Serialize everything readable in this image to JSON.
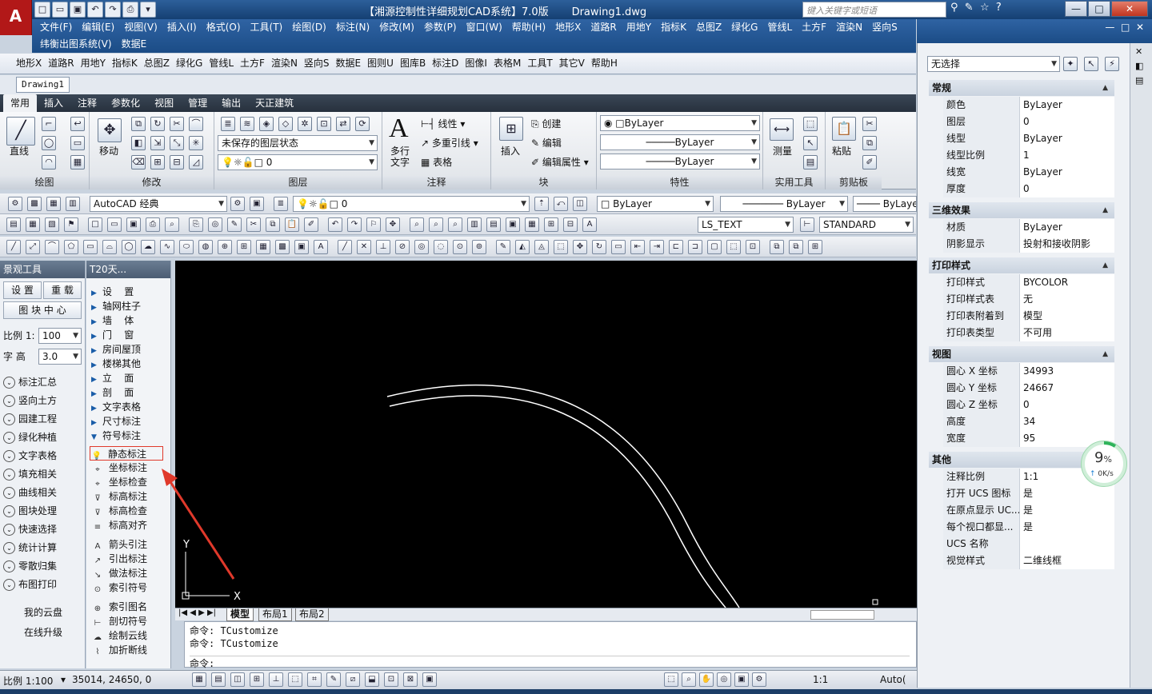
{
  "titlebar": {
    "app_logo": "A",
    "title": "【湘源控制性详细规划CAD系统】7.0版       Drawing1.dwg",
    "search_placeholder": "键入关键字或短语",
    "min": "—",
    "max": "□",
    "close": "✕"
  },
  "menubar": {
    "row1": [
      "文件(F)",
      "编辑(E)",
      "视图(V)",
      "插入(I)",
      "格式(O)",
      "工具(T)",
      "绘图(D)",
      "标注(N)",
      "修改(M)",
      "参数(P)",
      "窗口(W)",
      "帮助(H)",
      "地形X",
      "道路R",
      "用地Y",
      "指标K",
      "总图Z",
      "绿化G",
      "管线L",
      "土方F",
      "渲染N",
      "竖向S"
    ],
    "row2": [
      "纬衡出图系统(V)",
      "数据E"
    ]
  },
  "toolbar2": [
    "地形X",
    "道路R",
    "用地Y",
    "指标K",
    "总图Z",
    "绿化G",
    "管线L",
    "土方F",
    "渲染N",
    "竖向S",
    "数据E",
    "图则U",
    "图库B",
    "标注D",
    "图像I",
    "表格M",
    "工具T",
    "其它V",
    "帮助H"
  ],
  "doc_tab": "Drawing1",
  "ribbon_tabs": [
    "常用",
    "插入",
    "注释",
    "参数化",
    "视图",
    "管理",
    "输出",
    "天正建筑"
  ],
  "ribbon": {
    "draw_title": "绘图",
    "line_label": "直线",
    "modify_title": "修改",
    "move_label": "移动",
    "layers_title": "图层",
    "layer_state": "未保存的图层状态",
    "layer_current": "0",
    "annot_title": "注释",
    "mtext_label": "多行\n文字",
    "linear_label": "线性",
    "mleader_label": "多重引线",
    "table_label": "表格",
    "block_title": "块",
    "insert_label": "插入",
    "create_label": "创建",
    "edit_label": "编辑",
    "editattr_label": "编辑属性",
    "props_title": "特性",
    "color": "ByLayer",
    "linetype": "ByLayer",
    "lineweight": "ByLayer",
    "utils_title": "实用工具",
    "measure_label": "测量",
    "clip_title": "剪贴板",
    "paste_label": "粘贴"
  },
  "toolbar_ws": {
    "workspace": "AutoCAD 经典",
    "layer": "0",
    "color": "ByLayer",
    "linetype": "ByLayer",
    "lineweight": "ByLaye"
  },
  "toolbar_std": {
    "textstyle": "LS_TEXT",
    "dimstyle": "STANDARD"
  },
  "left_panel": {
    "title": "景观工具",
    "btn_settings": "设 置",
    "btn_redraw": "重 载",
    "btn_center": "图 块 中 心",
    "scale_label": "比例 1:",
    "scale_value": "100",
    "height_label": "字 高",
    "height_value": "3.0",
    "items": [
      "标注汇总",
      "竖向土方",
      "园建工程",
      "绿化种植",
      "文字表格",
      "填充相关",
      "曲线相关",
      "图块处理",
      "快速选择",
      "统计计算",
      "零散归集",
      "布图打印"
    ],
    "cloud": "我的云盘",
    "upgrade": "在线升级"
  },
  "t20_panel": {
    "title": "T20天...",
    "menu": [
      "设    置",
      "轴网柱子",
      "墙    体",
      "门    窗",
      "房间屋顶",
      "楼梯其他",
      "立    面",
      "剖    面",
      "文字表格",
      "尺寸标注",
      "符号标注"
    ],
    "sub": [
      "静态标注",
      "坐标标注",
      "坐标检查",
      "标高标注",
      "标高检查",
      "标高对齐",
      "箭头引注",
      "引出标注",
      "做法标注",
      "索引符号",
      "索引图名",
      "剖切符号",
      "绘制云线",
      "加折断线"
    ]
  },
  "canvas": {
    "axis_y": "Y",
    "axis_x": "X"
  },
  "layout_tabs": [
    "模型",
    "布局1",
    "布局2"
  ],
  "cmdline": {
    "line1": "命令: TCustomize",
    "line2": "命令: TCustomize",
    "prompt": "命令:"
  },
  "statusbar": {
    "scale": "比例 1:100",
    "coords": "35014, 24650, 0",
    "anno": "1:1",
    "brand": "Auto("
  },
  "props": {
    "selection": "无选择",
    "sections": [
      {
        "title": "常规",
        "rows": [
          [
            "颜色",
            "ByLayer"
          ],
          [
            "图层",
            "0"
          ],
          [
            "线型",
            "ByLayer"
          ],
          [
            "线型比例",
            "1"
          ],
          [
            "线宽",
            "ByLayer"
          ],
          [
            "厚度",
            "0"
          ]
        ]
      },
      {
        "title": "三维效果",
        "rows": [
          [
            "材质",
            "ByLayer"
          ],
          [
            "阴影显示",
            "投射和接收阴影"
          ]
        ]
      },
      {
        "title": "打印样式",
        "rows": [
          [
            "打印样式",
            "BYCOLOR"
          ],
          [
            "打印样式表",
            "无"
          ],
          [
            "打印表附着到",
            "模型"
          ],
          [
            "打印表类型",
            "不可用"
          ]
        ]
      },
      {
        "title": "视图",
        "rows": [
          [
            "圆心 X 坐标",
            "34993"
          ],
          [
            "圆心 Y 坐标",
            "24667"
          ],
          [
            "圆心 Z 坐标",
            "0"
          ],
          [
            "高度",
            "34"
          ],
          [
            "宽度",
            "95"
          ]
        ]
      },
      {
        "title": "其他",
        "rows": [
          [
            "注释比例",
            "1:1"
          ],
          [
            "打开 UCS 图标",
            "是"
          ],
          [
            "在原点显示 UC...",
            "是"
          ],
          [
            "每个视口都显...",
            "是"
          ],
          [
            "UCS 名称",
            ""
          ],
          [
            "视觉样式",
            "二维线框"
          ]
        ]
      }
    ]
  },
  "progress": {
    "value": "9",
    "unit": "%",
    "speed": "0K/s",
    "level": 0.09
  }
}
